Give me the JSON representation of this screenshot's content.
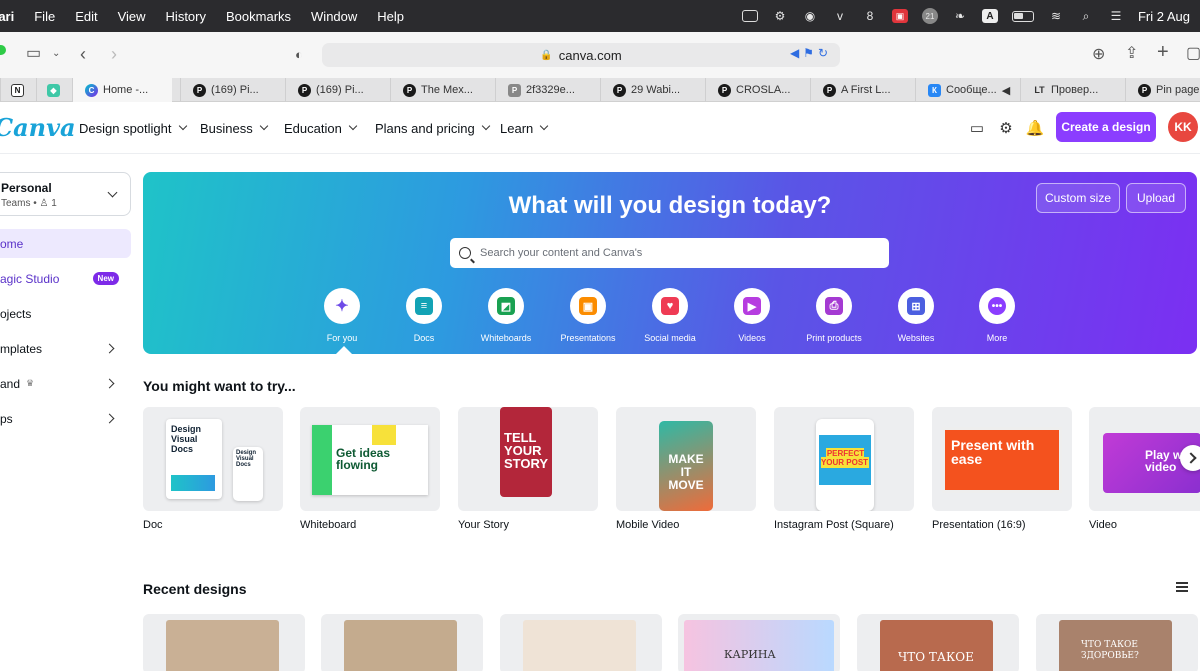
{
  "menubar": {
    "app": "fari",
    "items": [
      "File",
      "Edit",
      "View",
      "History",
      "Bookmarks",
      "Window",
      "Help"
    ],
    "badge_21": "21",
    "badge_a": "A",
    "clock": "Fri 2 Aug"
  },
  "browser": {
    "url": "canva.com",
    "tabs": [
      {
        "label": "Home -...",
        "icon": "canva-icon"
      },
      {
        "label": "(169) Pi...",
        "icon": "pinterest-icon"
      },
      {
        "label": "(169) Pi...",
        "icon": "pinterest-icon"
      },
      {
        "label": "The Mex...",
        "icon": "pinterest-icon"
      },
      {
        "label": "2f3329e...",
        "icon": "p-icon"
      },
      {
        "label": "29 Wabi...",
        "icon": "pinterest-icon"
      },
      {
        "label": "CROSLA...",
        "icon": "pinterest-icon"
      },
      {
        "label": "A First L...",
        "icon": "pinterest-icon"
      },
      {
        "label": "Сообще...",
        "icon": "vk-icon"
      },
      {
        "label": "Провер...",
        "icon": "lt-icon"
      },
      {
        "label": "Pin page",
        "icon": "pinterest-icon"
      }
    ]
  },
  "header": {
    "logo": "Canva",
    "nav": [
      "Design spotlight",
      "Business",
      "Education",
      "Plans and pricing",
      "Learn"
    ],
    "create_label": "Create a design",
    "avatar": "KK"
  },
  "sidebar": {
    "team_name": "Personal",
    "team_sub": "Teams • ♙ 1",
    "items": [
      "ome",
      "agic Studio",
      "ojects",
      "mplates",
      "and",
      "ps"
    ],
    "new_badge": "New"
  },
  "hero": {
    "title": "What will you design today?",
    "search_placeholder": "Search your content and Canva's",
    "custom_size": "Custom size",
    "upload": "Upload",
    "categories": [
      "For you",
      "Docs",
      "Whiteboards",
      "Presentations",
      "Social media",
      "Videos",
      "Print products",
      "Websites",
      "More"
    ]
  },
  "try": {
    "title": "You might want to try...",
    "cards": [
      "Doc",
      "Whiteboard",
      "Your Story",
      "Mobile Video",
      "Instagram Post (Square)",
      "Presentation (16:9)",
      "Video"
    ],
    "thumb_text": {
      "doc": "Design Visual Docs",
      "doc_small": "Design Visual Docs",
      "whiteboard": "Get ideas flowing",
      "story": "TELL YOUR STORY",
      "mobile": "MAKE IT MOVE",
      "insta": "PERFECT YOUR POST",
      "presentation": "Present with ease",
      "video": "Play with video"
    }
  },
  "recent": {
    "title": "Recent designs",
    "thumb_text": [
      "КАРИНА",
      "ЧТО ТАКОЕ",
      "ЧТО ТАКОЕ ЗДОРОВЬЕ?"
    ]
  },
  "colors": {
    "accent": "#8b3dff",
    "hero_start": "#1fc3c8",
    "hero_end": "#7b2ff2"
  }
}
